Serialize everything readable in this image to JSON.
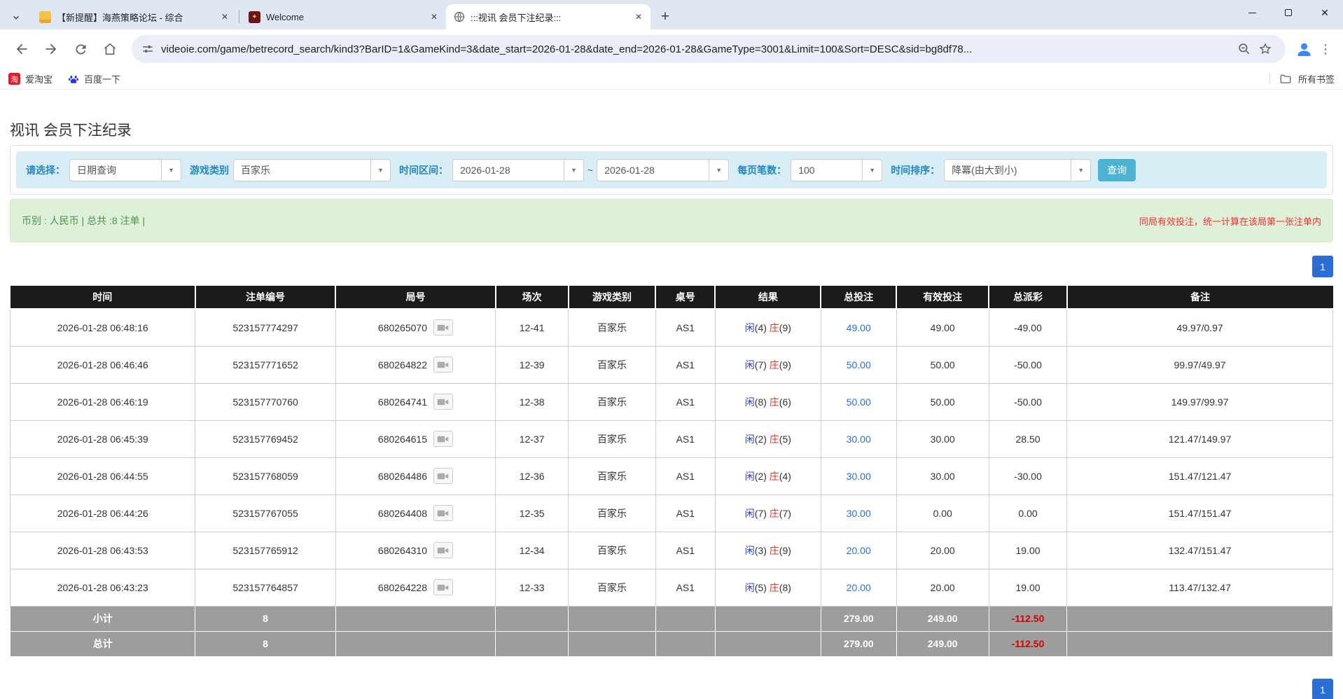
{
  "browser": {
    "tabs": [
      {
        "title": "【新提醒】海燕策略论坛 - 综合",
        "icon": "yellow-doc",
        "active": false
      },
      {
        "title": "Welcome",
        "icon": "maroon-logo",
        "active": false
      },
      {
        "title": ":::视讯 会员下注纪录:::",
        "icon": "globe",
        "active": true
      }
    ],
    "url": "videoie.com/game/betrecord_search/kind3?BarID=1&GameKind=3&date_start=2026-01-28&date_end=2026-01-28&GameType=3001&Limit=100&Sort=DESC&sid=bg8df78...",
    "bookmarks": [
      {
        "label": "爱淘宝",
        "icon": "taobao"
      },
      {
        "label": "百度一下",
        "icon": "baidu-paw"
      }
    ],
    "bookmarks_all_label": "所有书签"
  },
  "page": {
    "title": "视讯 会员下注纪录",
    "filters": {
      "select_label": "请选择：",
      "select_value": "日期查询",
      "game_type_label": "游戏类别",
      "game_type_value": "百家乐",
      "date_range_label": "时间区间：",
      "date_start": "2026-01-28",
      "tilde": "~",
      "date_end": "2026-01-28",
      "per_page_label": "每页笔数：",
      "per_page_value": "100",
      "sort_label": "时间排序：",
      "sort_value": "降冪(由大到小)",
      "search_button": "查询"
    },
    "info_bar": {
      "left": "币别 : 人民币 | 总共 :8 注单 |",
      "right": "同局有效投注，统一计算在该局第一张注单内"
    },
    "pagination": "1",
    "table": {
      "headers": [
        "时间",
        "注单编号",
        "局号",
        "场次",
        "游戏类别",
        "桌号",
        "结果",
        "总投注",
        "有效投注",
        "总派彩",
        "备注"
      ],
      "rows": [
        {
          "time": "2026-01-28 06:48:16",
          "bet_no": "523157774297",
          "round_no": "680265070",
          "session": "12-41",
          "game": "百家乐",
          "table_no": "AS1",
          "result": {
            "player": "闲",
            "player_score": "(4)",
            "banker": "庄",
            "banker_score": "(9)"
          },
          "total_bet": "49.00",
          "valid_bet": "49.00",
          "payout": "-49.00",
          "remark": "49.97/0.97"
        },
        {
          "time": "2026-01-28 06:46:46",
          "bet_no": "523157771652",
          "round_no": "680264822",
          "session": "12-39",
          "game": "百家乐",
          "table_no": "AS1",
          "result": {
            "player": "闲",
            "player_score": "(7)",
            "banker": "庄",
            "banker_score": "(9)"
          },
          "total_bet": "50.00",
          "valid_bet": "50.00",
          "payout": "-50.00",
          "remark": "99.97/49.97"
        },
        {
          "time": "2026-01-28 06:46:19",
          "bet_no": "523157770760",
          "round_no": "680264741",
          "session": "12-38",
          "game": "百家乐",
          "table_no": "AS1",
          "result": {
            "player": "闲",
            "player_score": "(8)",
            "banker": "庄",
            "banker_score": "(6)"
          },
          "total_bet": "50.00",
          "valid_bet": "50.00",
          "payout": "-50.00",
          "remark": "149.97/99.97"
        },
        {
          "time": "2026-01-28 06:45:39",
          "bet_no": "523157769452",
          "round_no": "680264615",
          "session": "12-37",
          "game": "百家乐",
          "table_no": "AS1",
          "result": {
            "player": "闲",
            "player_score": "(2)",
            "banker": "庄",
            "banker_score": "(5)"
          },
          "total_bet": "30.00",
          "valid_bet": "30.00",
          "payout": "28.50",
          "remark": "121.47/149.97"
        },
        {
          "time": "2026-01-28 06:44:55",
          "bet_no": "523157768059",
          "round_no": "680264486",
          "session": "12-36",
          "game": "百家乐",
          "table_no": "AS1",
          "result": {
            "player": "闲",
            "player_score": "(2)",
            "banker": "庄",
            "banker_score": "(4)"
          },
          "total_bet": "30.00",
          "valid_bet": "30.00",
          "payout": "-30.00",
          "remark": "151.47/121.47"
        },
        {
          "time": "2026-01-28 06:44:26",
          "bet_no": "523157767055",
          "round_no": "680264408",
          "session": "12-35",
          "game": "百家乐",
          "table_no": "AS1",
          "result": {
            "player": "闲",
            "player_score": "(7)",
            "banker": "庄",
            "banker_score": "(7)"
          },
          "total_bet": "30.00",
          "valid_bet": "0.00",
          "payout": "0.00",
          "remark": "151.47/151.47"
        },
        {
          "time": "2026-01-28 06:43:53",
          "bet_no": "523157765912",
          "round_no": "680264310",
          "session": "12-34",
          "game": "百家乐",
          "table_no": "AS1",
          "result": {
            "player": "闲",
            "player_score": "(3)",
            "banker": "庄",
            "banker_score": "(9)"
          },
          "total_bet": "20.00",
          "valid_bet": "20.00",
          "payout": "19.00",
          "remark": "132.47/151.47"
        },
        {
          "time": "2026-01-28 06:43:23",
          "bet_no": "523157764857",
          "round_no": "680264228",
          "session": "12-33",
          "game": "百家乐",
          "table_no": "AS1",
          "result": {
            "player": "闲",
            "player_score": "(5)",
            "banker": "庄",
            "banker_score": "(8)"
          },
          "total_bet": "20.00",
          "valid_bet": "20.00",
          "payout": "19.00",
          "remark": "113.47/132.47"
        }
      ],
      "subtotal": {
        "label": "小计",
        "bet_no": "8",
        "total_bet": "279.00",
        "valid_bet": "249.00",
        "payout": "-112.50"
      },
      "total": {
        "label": "总计",
        "bet_no": "8",
        "total_bet": "279.00",
        "valid_bet": "249.00",
        "payout": "-112.50"
      }
    }
  },
  "colors": {
    "tabstrip_bg": "#dfe7f5",
    "urlbar_bg": "#e9eef9",
    "filter_box_bg": "#d9edf7",
    "filter_label_blue": "#2387c0",
    "search_button_teal": "#4cb3d3",
    "info_bar_bg": "#dff0d8",
    "info_text_green": "#4a934a",
    "warning_red": "#f03030",
    "table_header_bg": "#1b1b1b",
    "footer_row_bg": "#9d9d9d",
    "amount_blue": "#2b6cd9",
    "player_blue": "#2b3cd9",
    "banker_red": "#e53333",
    "pagination_blue": "#2b6fd4"
  }
}
